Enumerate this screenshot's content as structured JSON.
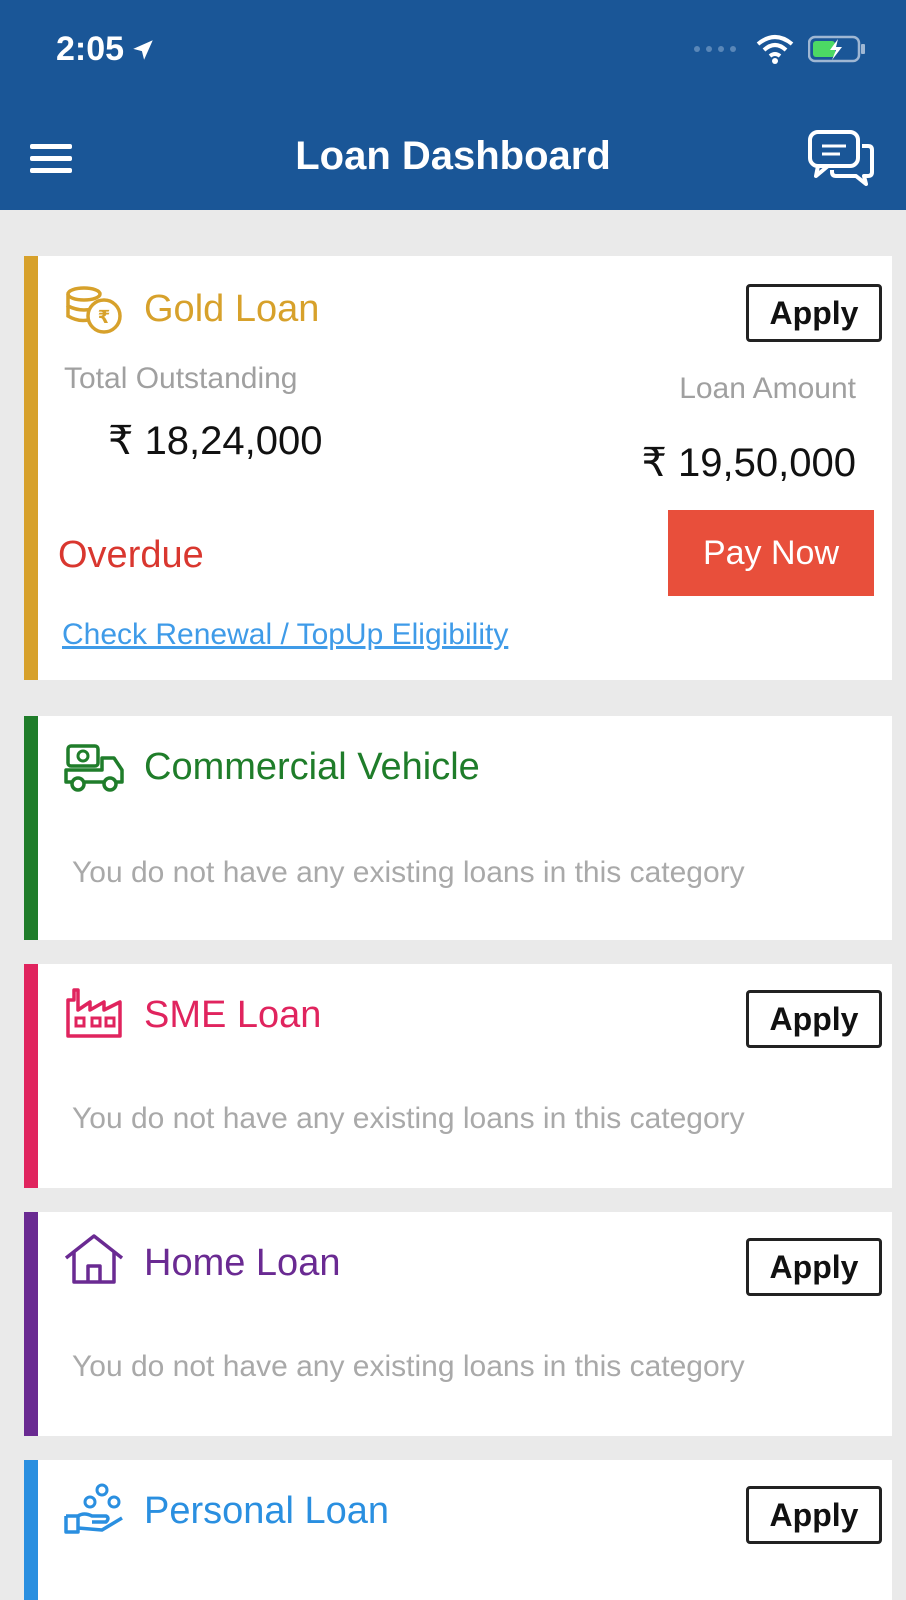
{
  "status_bar": {
    "time": "2:05"
  },
  "header": {
    "title": "Loan Dashboard"
  },
  "cards": {
    "gold": {
      "title": "Gold Loan",
      "apply_label": "Apply",
      "outstanding_label": "Total Outstanding",
      "outstanding_value": "₹ 18,24,000",
      "loan_amount_label": "Loan Amount",
      "loan_amount_value": "₹ 19,50,000",
      "status": "Overdue",
      "pay_label": "Pay Now",
      "link": "Check Renewal / TopUp Eligibility",
      "color": "#d7a12b"
    },
    "commercial": {
      "title": "Commercial Vehicle",
      "empty_message": "You do not have any existing loans in this category",
      "color": "#1f7d2a"
    },
    "sme": {
      "title": "SME Loan",
      "apply_label": "Apply",
      "empty_message": "You do not have any existing loans in this category",
      "color": "#e0245e"
    },
    "home": {
      "title": "Home Loan",
      "apply_label": "Apply",
      "empty_message": "You do not have any existing loans in this category",
      "color": "#6a2a92"
    },
    "personal": {
      "title": "Personal Loan",
      "apply_label": "Apply",
      "color": "#2a8fe0"
    }
  },
  "icons": {
    "menu": "hamburger-icon",
    "chat": "chat-bubbles-icon",
    "gold": "coins-icon",
    "commercial": "truck-money-icon",
    "sme": "factory-icon",
    "home": "house-icon",
    "personal": "hand-people-icon"
  }
}
